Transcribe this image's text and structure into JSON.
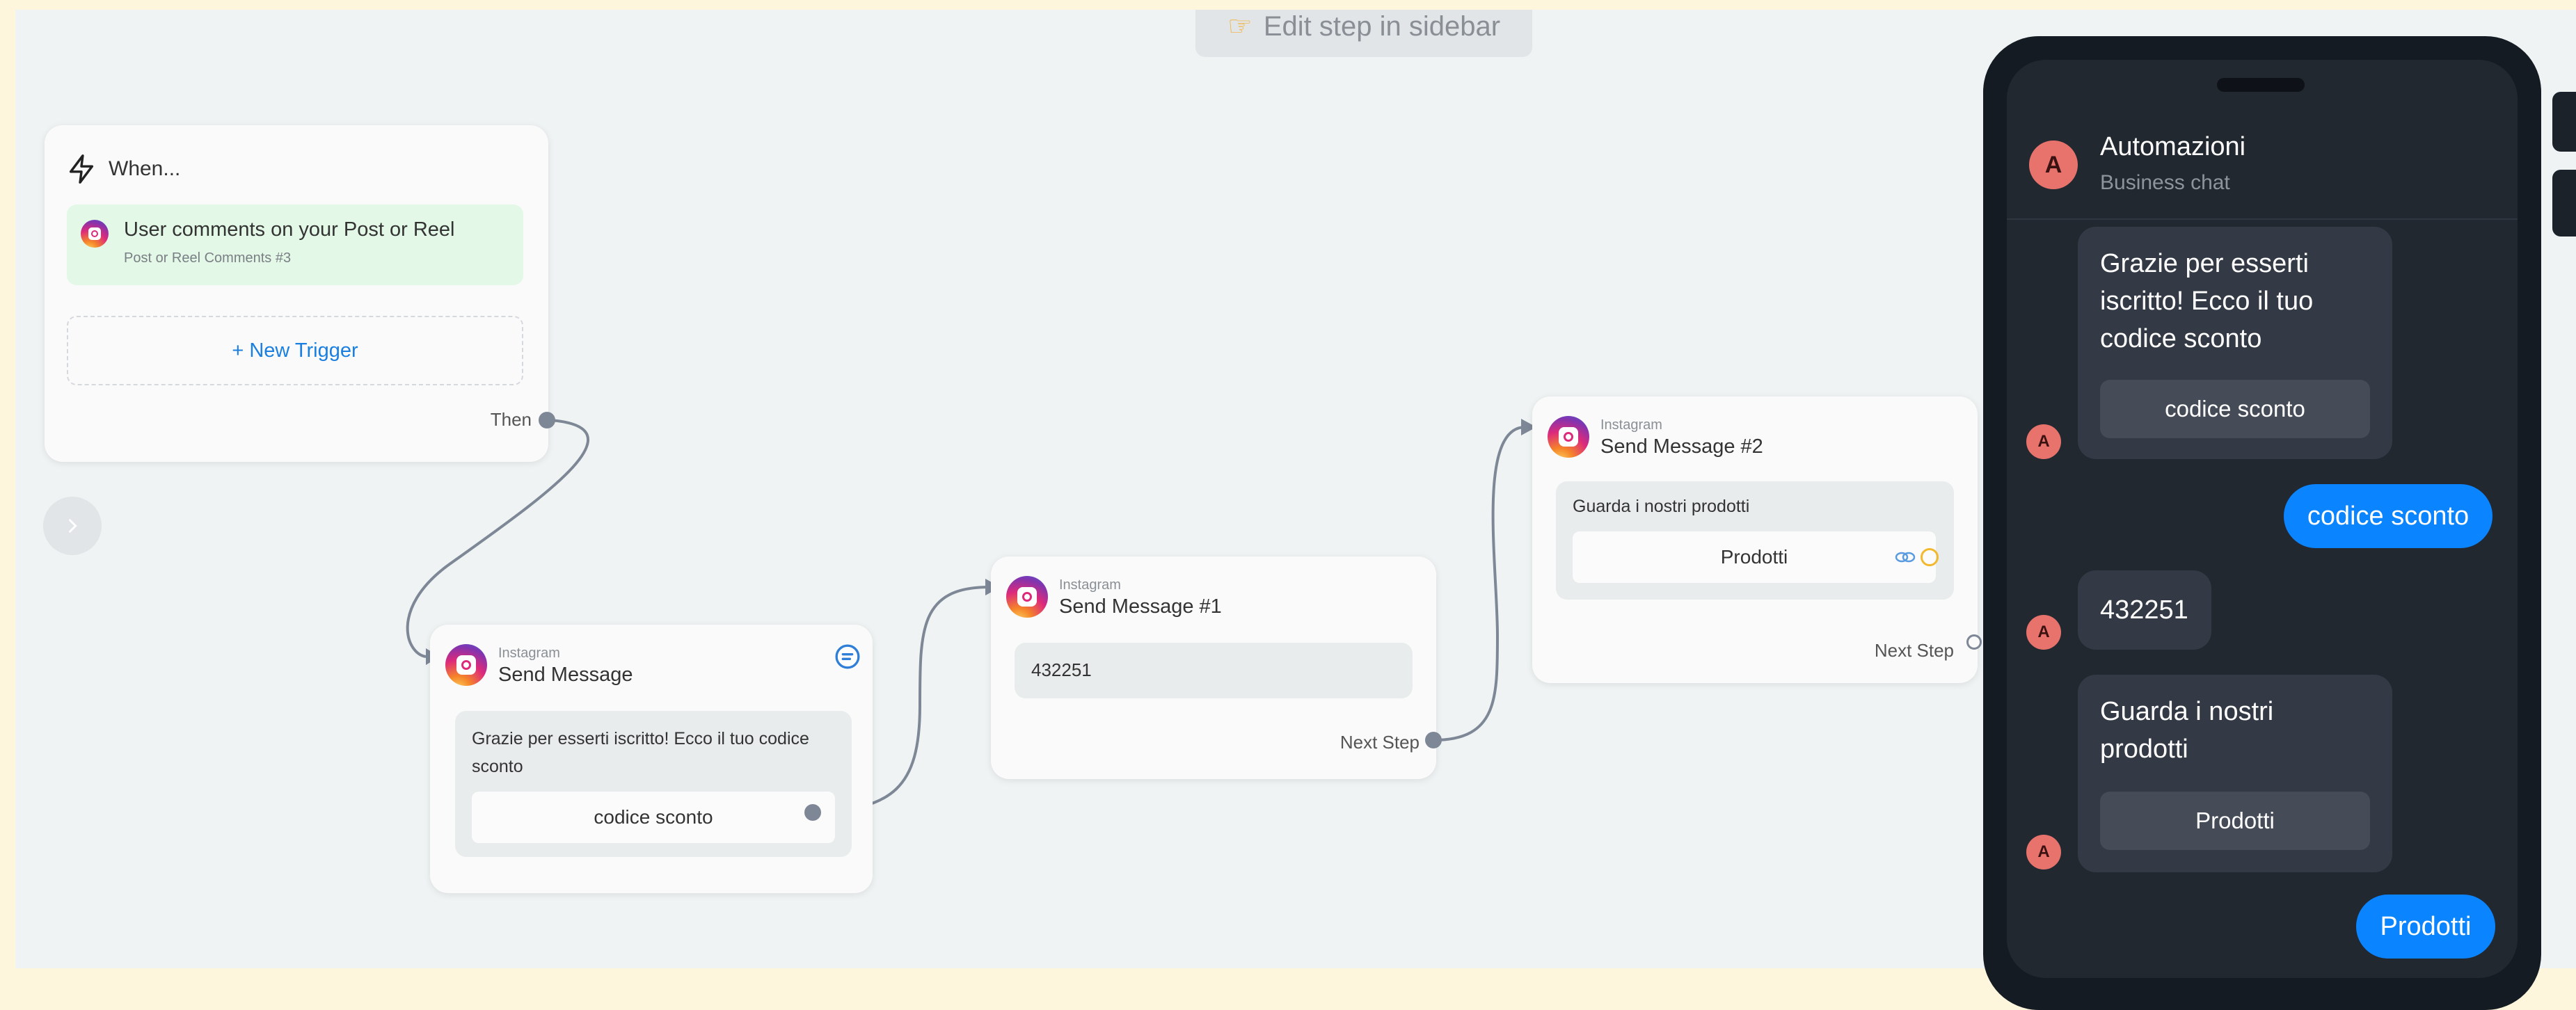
{
  "hint": {
    "icon": "pointing-hand-icon",
    "label": "Edit step in sidebar"
  },
  "trigger_card": {
    "header_icon": "lightning-icon",
    "header_label": "When...",
    "trigger_icon": "instagram-icon",
    "trigger_title": "User comments on your Post or Reel",
    "trigger_subtitle": "Post or Reel Comments #3",
    "new_trigger_label": "+ New Trigger",
    "then_label": "Then"
  },
  "expand_button_icon": "chevron-right-icon",
  "send_message": {
    "kicker": "Instagram",
    "title": "Send Message",
    "badge_icon": "chat-bubble-icon",
    "text": "Grazie per esserti iscritto! Ecco il tuo codice sconto",
    "button": "codice sconto"
  },
  "send_message_1": {
    "kicker": "Instagram",
    "title": "Send Message #1",
    "text": "432251",
    "next_label": "Next Step"
  },
  "send_message_2": {
    "kicker": "Instagram",
    "title": "Send Message #2",
    "text": "Guarda i nostri prodotti",
    "button": "Prodotti",
    "link_icon": "link-icon",
    "next_label": "Next Step"
  },
  "preview": {
    "avatar_letter": "A",
    "name": "Automazioni",
    "subtitle": "Business chat",
    "messages": [
      {
        "from": "bot",
        "text": "Grazie per esserti iscritto! Ecco il tuo codice sconto",
        "button": "codice sconto"
      },
      {
        "from": "user",
        "text": "codice sconto"
      },
      {
        "from": "bot",
        "text": "432251"
      },
      {
        "from": "bot",
        "text": "Guarda i nostri prodotti",
        "button": "Prodotti"
      },
      {
        "from": "user",
        "text": "Prodotti"
      }
    ]
  },
  "colors": {
    "canvas": "#eff3f3",
    "trigger_green": "#e3f8e6",
    "link_blue": "#1a7fe0",
    "user_bubble": "#0a84ff",
    "phone": "#141b23",
    "avatar": "#e8736c"
  }
}
